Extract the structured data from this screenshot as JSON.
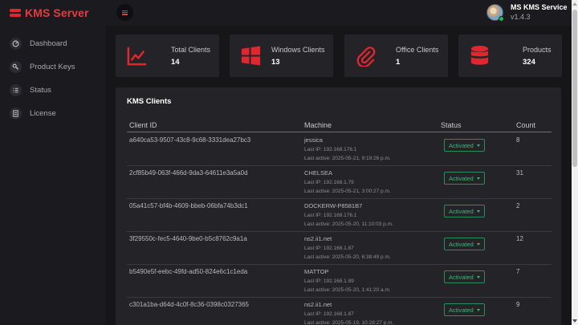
{
  "header": {
    "brand": "KMS Server",
    "profile_name": "MS KMS Service",
    "version": "v1.4.3"
  },
  "sidebar": {
    "items": [
      {
        "label": "Dashboard",
        "icon": "dashboard-icon"
      },
      {
        "label": "Product Keys",
        "icon": "key-icon"
      },
      {
        "label": "Status",
        "icon": "status-list-icon"
      },
      {
        "label": "License",
        "icon": "document-icon"
      }
    ]
  },
  "stats": [
    {
      "label": "Total Clients",
      "value": "14",
      "icon": "chart-line-icon"
    },
    {
      "label": "Windows Clients",
      "value": "13",
      "icon": "windows-icon"
    },
    {
      "label": "Office Clients",
      "value": "1",
      "icon": "paperclip-icon"
    },
    {
      "label": "Products",
      "value": "324",
      "icon": "database-icon"
    }
  ],
  "table": {
    "title": "KMS Clients",
    "columns": [
      "Client ID",
      "Machine",
      "Status",
      "Count"
    ],
    "rows": [
      {
        "client_id": "a640ca53-9507-43c8-9c68-3331dea27bc3",
        "machine": "jessica",
        "last_ip": "Last IP: 192.168.176.1",
        "last_active": "Last active: 2025-05-21, 9:19:26 p.m.",
        "status": "Activated",
        "count": "8"
      },
      {
        "client_id": "2cf85b49-063f-466d-9da3-64611e3a5a0d",
        "machine": "CHELSEA",
        "last_ip": "Last IP: 192.168.1.79",
        "last_active": "Last active: 2025-05-21, 3:00:27 p.m.",
        "status": "Activated",
        "count": "31"
      },
      {
        "client_id": "05a41c57-bf4b-4609-bbeb-06bfa74b3dc1",
        "machine": "DOCKERW-P8581B7",
        "last_ip": "Last IP: 192.168.176.1",
        "last_active": "Last active: 2025-05-20, 11:10:03 p.m.",
        "status": "Activated",
        "count": "2"
      },
      {
        "client_id": "3f29550c-fec5-4640-9be0-b5c8762c9a1a",
        "machine": "ns2.ii1.net",
        "last_ip": "Last IP: 192.168.1.87",
        "last_active": "Last active: 2025-05-20, 6:38:49 p.m.",
        "status": "Activated",
        "count": "12"
      },
      {
        "client_id": "b5490e5f-eebc-49fd-ad50-824e6c1c1eda",
        "machine": "MATTOP",
        "last_ip": "Last IP: 192.168.1.89",
        "last_active": "Last active: 2025-05-20, 1:41:20 a.m.",
        "status": "Activated",
        "count": "7"
      },
      {
        "client_id": "c301a1ba-d64d-4c0f-8c36-0398c0327365",
        "machine": "ns2.ii1.net",
        "last_ip": "Last IP: 192.168.1.87",
        "last_active": "Last active: 2025-05-19, 10:28:27 p.m.",
        "status": "Activated",
        "count": "9"
      }
    ]
  },
  "colors": {
    "accent": "#e0262f",
    "status_green": "#39b874",
    "background": "#161619",
    "card": "#242428"
  }
}
